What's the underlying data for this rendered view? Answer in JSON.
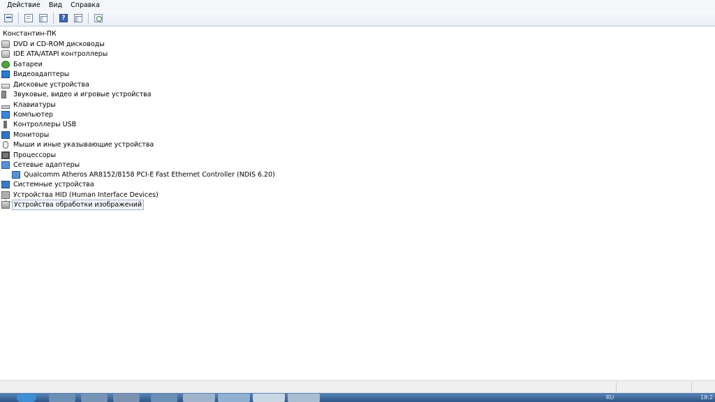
{
  "menu": [
    "Действие",
    "Вид",
    "Справка"
  ],
  "tree": {
    "root": "Константин-ПК",
    "categories": [
      {
        "label": "DVD и CD-ROM дисководы",
        "icon": "dvd-drive-icon"
      },
      {
        "label": "IDE ATA/ATAPI контроллеры",
        "icon": "ide-controller-icon"
      },
      {
        "label": "Батареи",
        "icon": "battery-icon"
      },
      {
        "label": "Видеоадаптеры",
        "icon": "video-adapter-icon"
      },
      {
        "label": "Дисковые устройства",
        "icon": "disk-drive-icon"
      },
      {
        "label": "Звуковые, видео и игровые устройства",
        "icon": "speaker-icon"
      },
      {
        "label": "Клавиатуры",
        "icon": "keyboard-icon"
      },
      {
        "label": "Компьютер",
        "icon": "computer-icon"
      },
      {
        "label": "Контроллеры USB",
        "icon": "usb-icon"
      },
      {
        "label": "Мониторы",
        "icon": "monitor-icon"
      },
      {
        "label": "Мыши и иные указывающие устройства",
        "icon": "mouse-icon"
      },
      {
        "label": "Процессоры",
        "icon": "processor-icon"
      },
      {
        "label": "Сетевые адаптеры",
        "icon": "network-adapter-icon"
      },
      {
        "label": "Qualcomm Atheros AR8152/8158 PCI-E Fast Ethernet Controller (NDIS 6.20)",
        "icon": "network-adapter-icon"
      },
      {
        "label": "Системные устройства",
        "icon": "system-device-icon"
      },
      {
        "label": "Устройства HID (Human Interface Devices)",
        "icon": "hid-icon"
      },
      {
        "label": "Устройства обработки изображений",
        "icon": "imaging-device-icon"
      }
    ]
  },
  "taskbar": {
    "tray_text": "RU",
    "clock": "18:2"
  }
}
